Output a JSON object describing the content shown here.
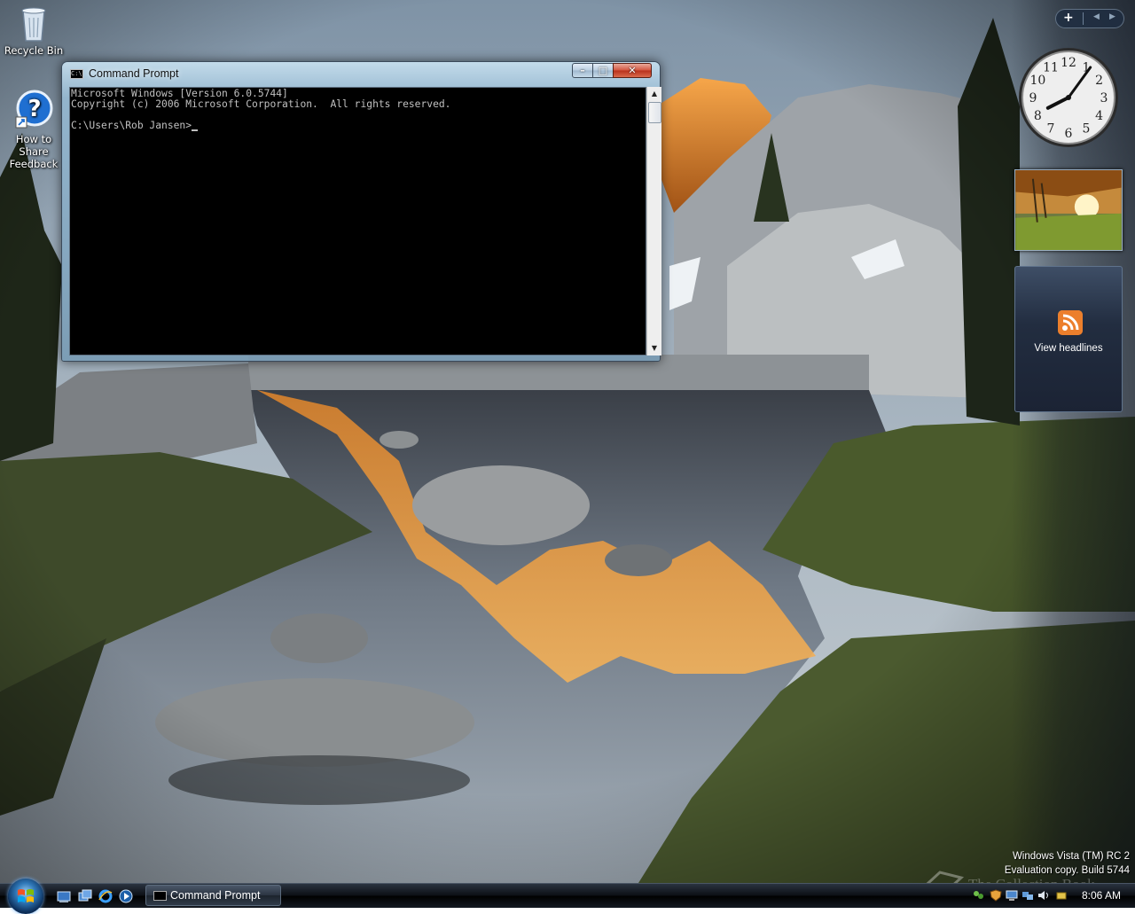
{
  "desktop": {
    "icons": [
      {
        "label": "Recycle Bin"
      },
      {
        "label": "How to Share Feedback"
      }
    ],
    "watermark": {
      "line1": "Windows Vista (TM) RC 2",
      "line2": "Evaluation copy. Build 5744"
    },
    "collection_watermark": "The Collection Book"
  },
  "cmd_window": {
    "title": "Command Prompt",
    "buttons": {
      "minimize": "–",
      "maximize": "□",
      "close": "✕"
    },
    "console_lines": [
      "Microsoft Windows [Version 6.0.5744]",
      "Copyright (c) 2006 Microsoft Corporation.  All rights reserved.",
      "",
      "C:\\Users\\Rob Jansen>"
    ]
  },
  "sidebar": {
    "add_label": "+",
    "prev_label": "◀",
    "next_label": "▶",
    "clock": {
      "hour": 8,
      "minute": 6,
      "numerals": [
        "12",
        "1",
        "2",
        "3",
        "4",
        "5",
        "6",
        "7",
        "8",
        "9",
        "10",
        "11"
      ]
    },
    "feed_gadget": {
      "label": "View headlines"
    }
  },
  "taskbar": {
    "tasks": [
      {
        "label": "Command Prompt"
      }
    ],
    "clock": "8:06 AM"
  },
  "colors": {
    "console_bg": "#000000",
    "console_fg": "#c0c0c0",
    "close_button": "#c8402a",
    "feed_orange": "#f0882e"
  }
}
